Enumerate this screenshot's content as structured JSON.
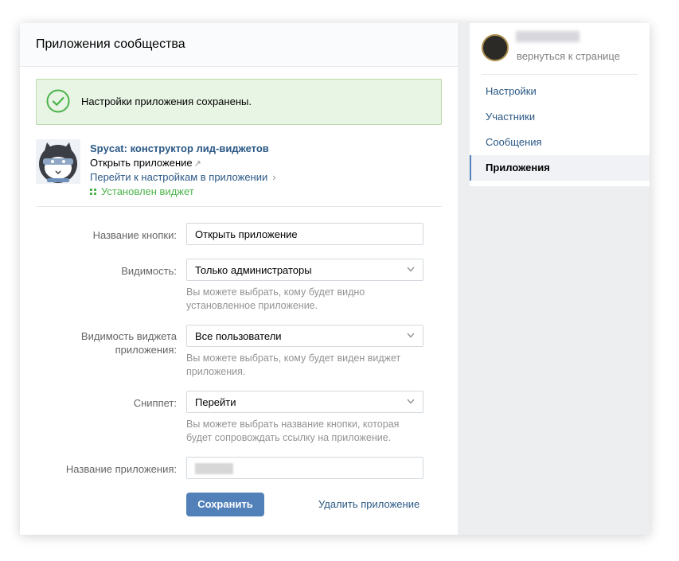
{
  "main": {
    "title": "Приложения сообщества",
    "success_message": "Настройки приложения сохранены.",
    "app": {
      "name": "Spycat: конструктор лид-виджетов",
      "open_label": "Открыть приложение",
      "open_arrow": "↗",
      "settings_link": "Перейти к настройкам в приложении",
      "settings_chevron": "›",
      "widget_status": "Установлен виджет"
    },
    "form": {
      "button_name_label": "Название кнопки:",
      "button_name_value": "Открыть приложение",
      "visibility_label": "Видимость:",
      "visibility_value": "Только администраторы",
      "visibility_hint": "Вы можете выбрать, кому будет видно установленное приложение.",
      "widget_visibility_label": "Видимость виджета приложения:",
      "widget_visibility_value": "Все пользователи",
      "widget_visibility_hint": "Вы можете выбрать, кому будет виден виджет приложения.",
      "snippet_label": "Сниппет:",
      "snippet_value": "Перейти",
      "snippet_hint": "Вы можете выбрать название кнопки, которая будет сопровождать ссылку на приложение.",
      "app_name_label": "Название приложения:"
    },
    "save_label": "Сохранить",
    "delete_label": "Удалить приложение"
  },
  "sidebar": {
    "back_label": "вернуться к странице",
    "items": [
      {
        "label": "Настройки"
      },
      {
        "label": "Участники"
      },
      {
        "label": "Сообщения"
      },
      {
        "label": "Приложения"
      }
    ]
  },
  "colors": {
    "accent": "#5181b8",
    "link": "#2a5885",
    "success_bg": "#e8f4e4",
    "success_green": "#4bb34b"
  },
  "icons": [
    "check-circle-icon",
    "spycat-logo",
    "external-arrow-icon",
    "chevron-right-icon",
    "grid-icon",
    "chevron-down-icon"
  ]
}
